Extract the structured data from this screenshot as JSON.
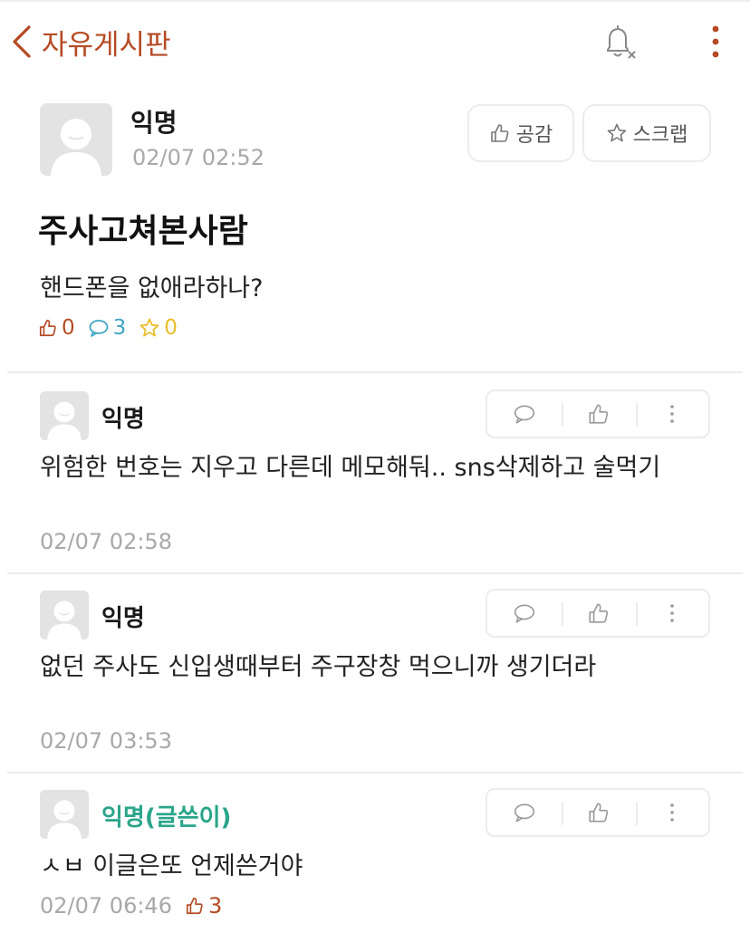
{
  "header": {
    "title": "자유게시판",
    "accent_color": "#b54a24",
    "back_icon": "chevron-left-icon",
    "bell_icon": "bell-off-icon",
    "more_icon": "more-vertical-icon"
  },
  "post": {
    "author": "익명",
    "time": "02/07 02:52",
    "like_button": "공감",
    "scrap_button": "스크랩",
    "title": "주사고쳐본사람",
    "body": "핸드폰을 없애라하나?",
    "stats": {
      "likes": "0",
      "comments": "3",
      "scraps": "0"
    }
  },
  "comments": [
    {
      "author": "익명",
      "text": "위험한 번호는 지우고 다른데 메모해둬.. sns삭제하고 술먹기",
      "time": "02/07 02:58"
    },
    {
      "author": "익명",
      "text": "없던 주사도 신입생때부터 주구장창 먹으니까 생기더라",
      "time": "02/07 03:53"
    },
    {
      "author": "익명(글쓴이)",
      "text": "ㅅㅂ 이글은또 언제쓴거야",
      "time": "02/07 06:46",
      "likes": "3"
    }
  ],
  "colors": {
    "op_author": "#2aa58a",
    "like": "#b54a24",
    "comment": "#3fa6c4",
    "scrap": "#e8bd2c",
    "muted": "#a8a8a8"
  }
}
